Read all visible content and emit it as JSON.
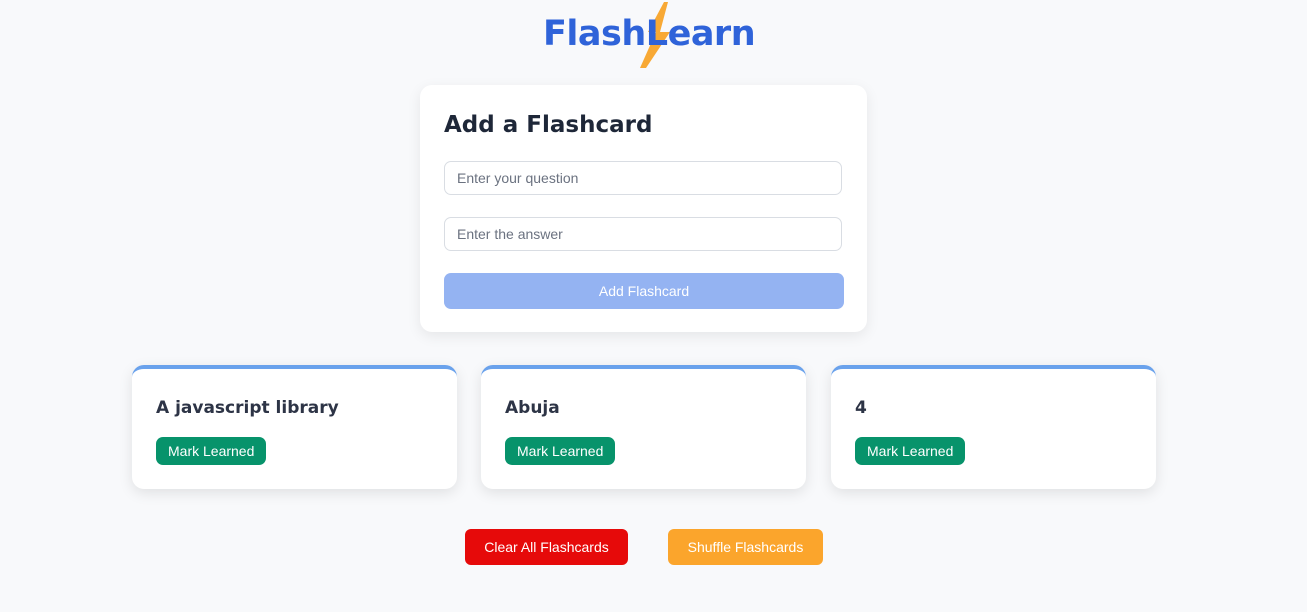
{
  "header": {
    "logo_text": "FlashLearn",
    "logo_icon": "lightning-bolt-icon",
    "brand_color": "#2f63d9",
    "bolt_color": "#f8a935"
  },
  "form": {
    "title": "Add a Flashcard",
    "question_placeholder": "Enter your question",
    "question_value": "",
    "answer_placeholder": "Enter the answer",
    "answer_value": "",
    "submit_label": "Add Flashcard",
    "submit_color": "#94b3f2"
  },
  "flashcards": [
    {
      "text": "A javascript library",
      "button_label": "Mark Learned"
    },
    {
      "text": "Abuja",
      "button_label": "Mark Learned"
    },
    {
      "text": "4",
      "button_label": "Mark Learned"
    }
  ],
  "actions": {
    "clear_label": "Clear All Flashcards",
    "clear_color": "#e60a0a",
    "shuffle_label": "Shuffle Flashcards",
    "shuffle_color": "#fba52c"
  }
}
